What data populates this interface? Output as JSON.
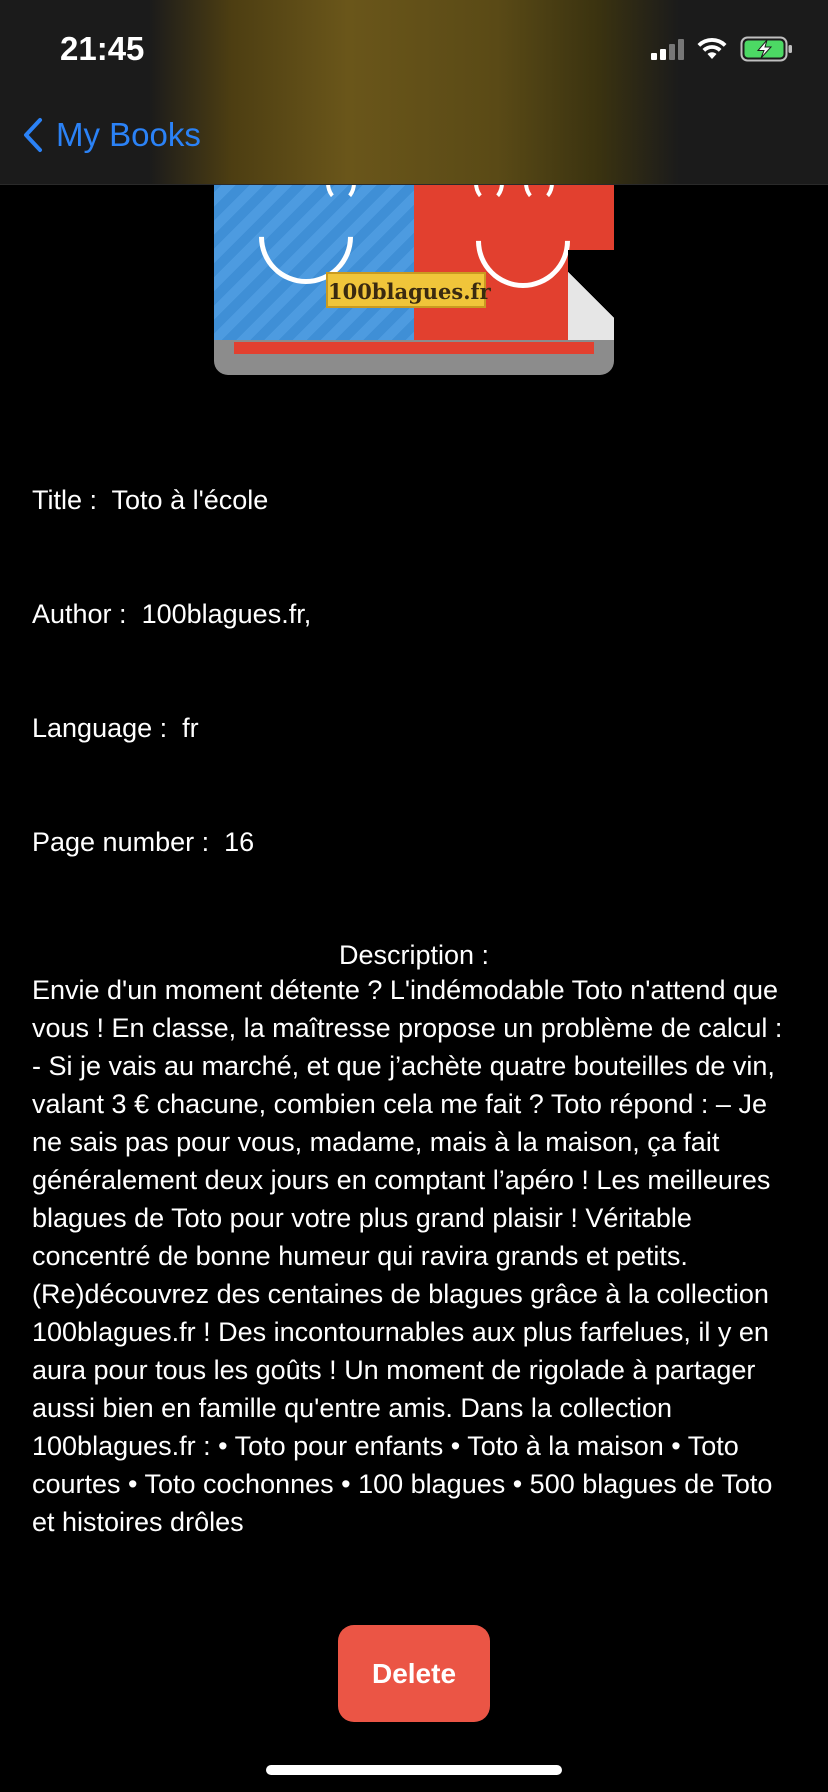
{
  "status_bar": {
    "time": "21:45"
  },
  "nav": {
    "back_label": "My Books"
  },
  "cover": {
    "label": "100blagues.fr"
  },
  "book": {
    "title_label": "Title :  ",
    "title_value": "Toto à l'école",
    "author_label": "Author :  ",
    "author_value": "100blagues.fr,",
    "language_label": "Language :  ",
    "language_value": "fr",
    "pages_label": "Page number :  ",
    "pages_value": "16",
    "description_label": "Description :",
    "description": "Envie d'un moment détente ? L'indémodable Toto n'attend que vous ! En classe, la maîtresse propose un problème de calcul : - Si je vais au marché, et que j’achète quatre bouteilles de vin, valant 3 € chacune, combien cela me fait ? Toto répond : – Je ne sais pas pour vous, madame, mais à la maison, ça fait généralement deux jours en comptant l’apéro ! Les meilleures blagues de Toto pour votre plus grand plaisir ! Véritable concentré de bonne humeur qui ravira grands et petits. (Re)découvrez des centaines de blagues grâce à la collection 100blagues.fr ! Des incontournables aux plus farfelues, il y en aura pour tous les goûts ! Un moment de rigolade à partager aussi bien en famille qu'entre amis. Dans la collection 100blagues.fr : • Toto pour enfants • Toto à la maison • Toto courtes • Toto cochonnes • 100 blagues • 500 blagues de Toto et histoires drôles"
  },
  "actions": {
    "delete_label": "Delete"
  },
  "colors": {
    "accent": "#2b82f6",
    "delete": "#eb5545",
    "background": "#000000"
  }
}
